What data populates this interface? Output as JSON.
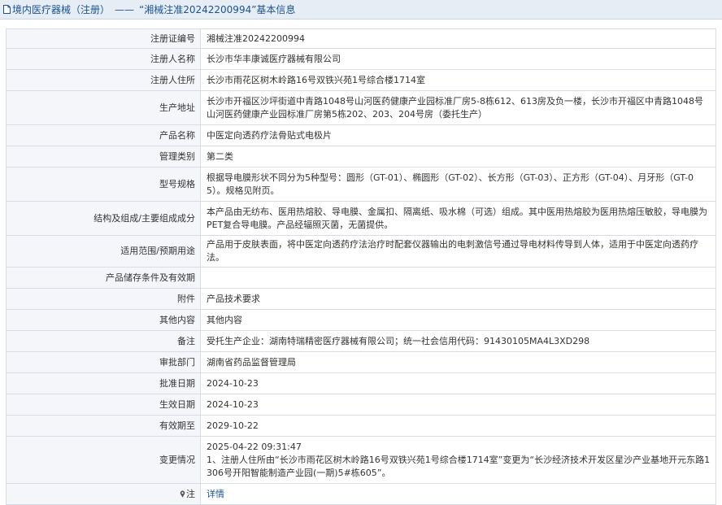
{
  "header": {
    "breadcrumb": "境内医疗器械（注册）",
    "separator": "——",
    "title": "“湘械注准20242200994”基本信息"
  },
  "rows": [
    {
      "label": "注册证编号",
      "value": "湘械注准20242200994"
    },
    {
      "label": "注册人名称",
      "value": "长沙市华丰康诚医疗器械有限公司"
    },
    {
      "label": "注册人住所",
      "value": "长沙市雨花区树木岭路16号双铁兴苑1号综合楼1714室"
    },
    {
      "label": "生产地址",
      "value": "长沙市开福区沙坪街道中青路1048号山河医药健康产业园标准厂房5-8栋612、613房及负一楼，长沙市开福区中青路1048号山河医药健康产业园标准厂房第5栋202、203、204号房（委托生产）"
    },
    {
      "label": "产品名称",
      "value": "中医定向透药疗法骨贴式电极片"
    },
    {
      "label": "管理类别",
      "value": "第二类"
    },
    {
      "label": "型号规格",
      "value": "根据导电膜形状不同分为5种型号：圆形（GT-01）、椭圆形（GT-02）、长方形（GT-03）、正方形（GT-04）、月牙形（GT-05）。规格见附页。"
    },
    {
      "label": "结构及组成/主要组成成分",
      "value": "本产品由无纺布、医用热熔胶、导电膜、金属扣、隔离纸、吸水棉（可选）组成。其中医用热熔胶为医用热熔压敏胶，导电膜为PET复合导电膜。产品经辐照灭菌，无菌提供。"
    },
    {
      "label": "适用范围/预期用途",
      "value": "产品用于皮肤表面，将中医定向透药疗法治疗时配套仪器输出的电刺激信号通过导电材料传导到人体，适用于中医定向透药疗法。"
    },
    {
      "label": "产品储存条件及有效期",
      "value": ""
    },
    {
      "label": "附件",
      "value": "产品技术要求"
    },
    {
      "label": "其他内容",
      "value": "其他内容"
    },
    {
      "label": "备注",
      "value": "受托生产企业：湖南特瑞精密医疗器械有限公司；统一社会信用代码：91430105MA4L3XD298"
    },
    {
      "label": "审批部门",
      "value": "湖南省药品监督管理局"
    },
    {
      "label": "批准日期",
      "value": "2024-10-23"
    },
    {
      "label": "生效日期",
      "value": "2024-10-23"
    },
    {
      "label": "有效期至",
      "value": "2029-10-22"
    }
  ],
  "change": {
    "label": "变更情况",
    "timestamp": "2025-04-22 09:31:47",
    "text": "1、注册人住所由“长沙市雨花区树木岭路16号双铁兴苑1号综合楼1714室”变更为“长沙经济技术开发区星沙产业基地开元东路1306号开阳智能制造产业园(一期)5#栋605”。"
  },
  "note": {
    "label": "注",
    "link_text": "详情",
    "icon": "pin-icon"
  },
  "colors": {
    "header_bg": "#e6edf5",
    "header_text": "#1a5394",
    "label_bg": "#f4f6f9",
    "border": "#d6dde6",
    "link": "#1a5394"
  }
}
